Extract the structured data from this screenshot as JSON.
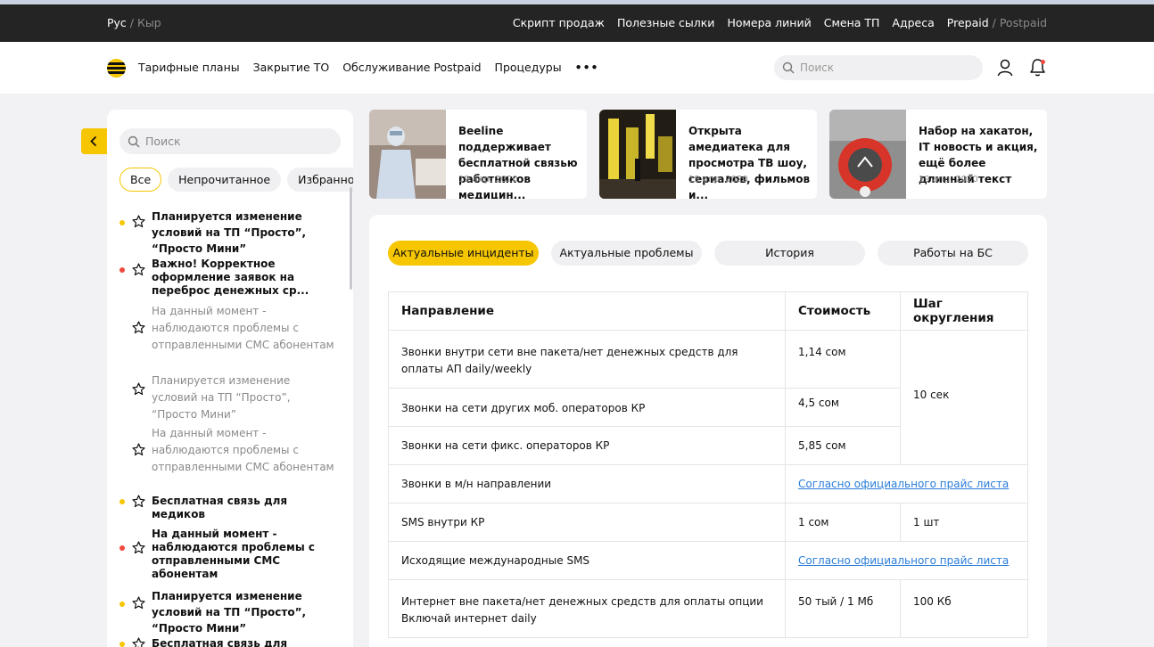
{
  "topbar": {
    "lang_active": "Рус",
    "lang_sep": "/",
    "lang_other": "Кыр",
    "links": [
      "Скрипт продаж",
      "Полезные сылки",
      "Номера линий",
      "Смена ТП",
      "Адреса"
    ],
    "plan_active": "Prepaid",
    "plan_sep": "/",
    "plan_other": "Postpaid"
  },
  "nav": {
    "items": [
      "Тарифные планы",
      "Закрытие ТО",
      "Обслуживание Postpaid",
      "Процедуры"
    ],
    "more": "•••",
    "search_placeholder": "Поиск"
  },
  "sidebar": {
    "search_placeholder": "Поиск",
    "filters": [
      "Все",
      "Непрочитанное",
      "Избранное"
    ],
    "items": [
      {
        "text": "Планируется изменение условий на ТП “Просто”, “Просто Мини”",
        "status": "unread",
        "dot": "#f6c600"
      },
      {
        "text": "Важно! Корректное оформление заявок на переброс денежных ср...",
        "status": "unread",
        "dot": "#f04a3e"
      },
      {
        "text": "На данный момент - наблюдаются проблемы с отправленными СМС абонентам",
        "status": "read",
        "dot": ""
      },
      {
        "text": "Планируется изменение условий на ТП “Просто”, “Просто Мини”",
        "status": "read",
        "dot": ""
      },
      {
        "text": "На данный момент - наблюдаются проблемы с отправленными СМС абонентам",
        "status": "read",
        "dot": ""
      },
      {
        "text": "Бесплатная связь для медиков",
        "status": "unread",
        "dot": "#f6c600"
      },
      {
        "text": "На данный момент - наблюдаются проблемы с отправленными СМС абонентам",
        "status": "unread",
        "dot": "#f04a3e"
      },
      {
        "text": "Планируется изменение условий на ТП “Просто”, “Просто Мини”",
        "status": "unread",
        "dot": "#f6c600"
      },
      {
        "text": "Бесплатная связь для медиков",
        "status": "unread",
        "dot": "#f6c600"
      }
    ]
  },
  "news": [
    {
      "title": "Beeline поддерживает бесплатной связью работников медицин...",
      "date": "19 апр. 2020"
    },
    {
      "title": "Открыта амедиатека для просмотра ТВ шоу, сериалов, фильмов и...",
      "date": "19 апр. 2020"
    },
    {
      "title": "Набор на хакатон, IT новость и акция, ещё более длинный текст",
      "date": "19 апр. 2020"
    }
  ],
  "tabs": [
    "Актуальные инциденты",
    "Актуальные проблемы",
    "История",
    "Работы на БС"
  ],
  "table": {
    "headers": [
      "Направление",
      "Стоимость",
      "Шаг округления"
    ],
    "rows": [
      {
        "direction": "Звонки внутри сети вне пакета/нет денежных средств для оплаты АП daily/weekly",
        "cost": "1,14 сом"
      },
      {
        "direction": "Звонки на сети других моб. операторов КР",
        "cost": "4,5 сом"
      },
      {
        "direction": "Звонки на сети фикс. операторов КР",
        "cost": "5,85 сом"
      },
      {
        "direction": "Звонки в м/н направлении",
        "link": "Согласно официального прайс листа"
      },
      {
        "direction": "SMS внутри КР",
        "cost": "1 сом",
        "step": "1 шт"
      },
      {
        "direction": "Исходящие международные SMS",
        "link": "Согласно официального прайс листа"
      },
      {
        "direction": "Интернет вне пакета/нет денежных средств для оплаты опции Включай интернет daily",
        "cost": "50 тый / 1 Мб",
        "step": "100 Кб"
      }
    ],
    "merged_step": "10 сек"
  },
  "colors": {
    "accent": "#f6c600",
    "dark": "#242424",
    "link": "#2a7dd9",
    "alert": "#f04a3e"
  }
}
